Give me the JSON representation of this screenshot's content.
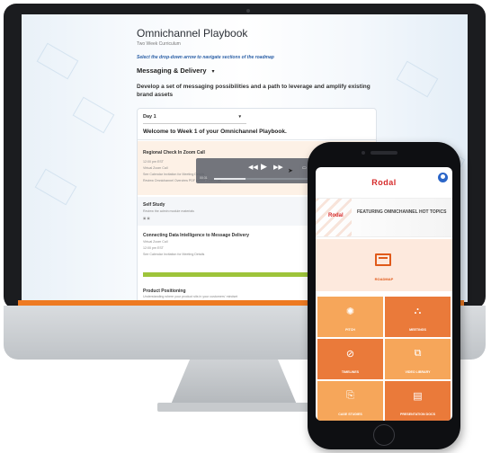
{
  "playbook": {
    "title": "Omnichannel Playbook",
    "subtitle": "Two Week Curriculum",
    "instruction": "Select the drop-down arrow to navigate sections of the roadmap",
    "section": "Messaging & Delivery",
    "description": "Develop a set of messaging possibilities and a path to leverage and amplify existing brand assets",
    "day": "Day 1",
    "welcome": "Welcome to Week 1 of your Omnichannel Playbook.",
    "items": [
      {
        "title": "Regional Check In Zoom Call",
        "lines": [
          "12:00 pm EST",
          "Virtual Zoom Call",
          "See Calendar Invitation for Meeting Details",
          "Review Omnichannel Overview PDF before Zoom Call"
        ]
      },
      {
        "title": "Self Study",
        "lines": [
          "Review the admin module materials"
        ]
      },
      {
        "title": "Connecting Data Intelligence to Message Delivery",
        "lines": [
          "Virtual Zoom Call",
          "12:00 pm EST",
          "See Calendar Invitation for Meeting Details"
        ]
      },
      {
        "title": "Product Positioning",
        "lines": [
          "Understanding where your product sits in your customers' mindset"
        ]
      }
    ],
    "progress": 1.0
  },
  "video": {
    "time_current": "00:31",
    "time_total": "02:02",
    "progress": 0.32
  },
  "phone": {
    "logo": "Rodal",
    "banner_logo": "Rodal",
    "banner_text": "FEATURING OMNICHANNEL HOT TOPICS",
    "roadmap_label": "ROADMAP",
    "tiles": [
      {
        "icon": "✺",
        "label": "PITCH"
      },
      {
        "icon": "⛬",
        "label": "MEETINGS"
      },
      {
        "icon": "⊘",
        "label": "TIMELINES"
      },
      {
        "icon": "⧉",
        "label": "VIDEO LIBRARY"
      },
      {
        "icon": "⎘",
        "label": "CASE STUDIES"
      },
      {
        "icon": "▤",
        "label": "PRESENTATION DOCS"
      }
    ],
    "colors": {
      "accent": "#ee7a22",
      "tile_light": "#f6a65a",
      "tile_dark": "#ea7a3a",
      "brand": "#d62a2a"
    }
  }
}
